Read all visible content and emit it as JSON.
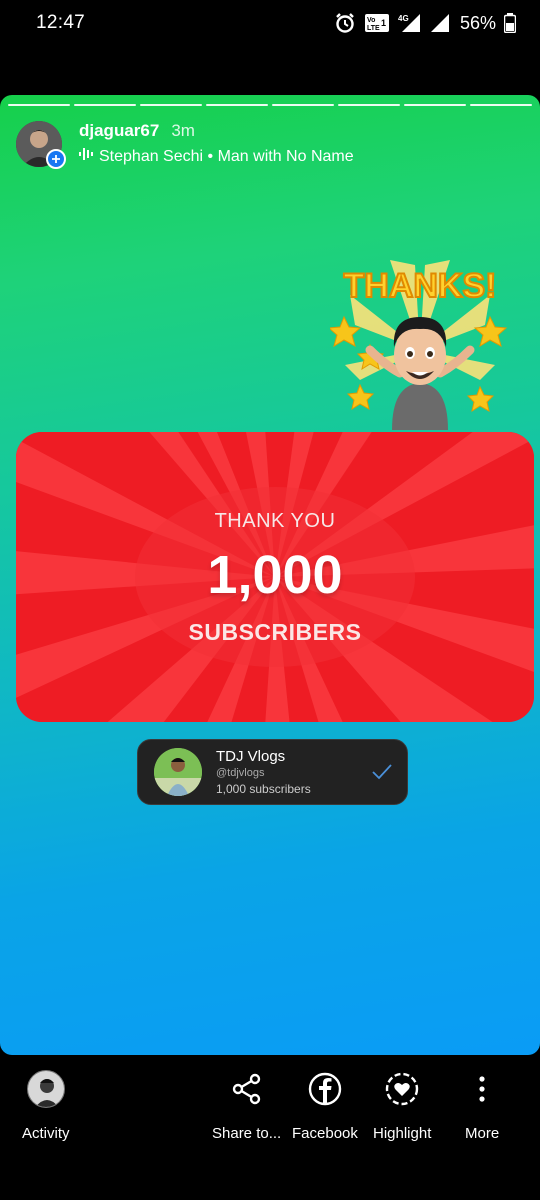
{
  "status_bar": {
    "time": "12:47",
    "battery": "56%"
  },
  "story": {
    "username": "djaguar67",
    "time_ago": "3m",
    "music": "Stephan Sechi • Man with No Name",
    "segments": 8,
    "card": {
      "thank_you": "THANK YOU",
      "count": "1,000",
      "subscribers": "SUBSCRIBERS"
    },
    "sticker_text": "THANKS!",
    "channel": {
      "name": "TDJ Vlogs",
      "handle": "@tdjvlogs",
      "subscribers": "1,000 subscribers"
    }
  },
  "bottom_bar": {
    "activity": "Activity",
    "share": "Share to...",
    "facebook": "Facebook",
    "highlight": "Highlight",
    "more": "More"
  },
  "colors": {
    "gradient_top": "#16d04a",
    "gradient_bottom": "#0a9cf6",
    "card_red": "#ee1c24",
    "badge_blue": "#1877f2"
  }
}
